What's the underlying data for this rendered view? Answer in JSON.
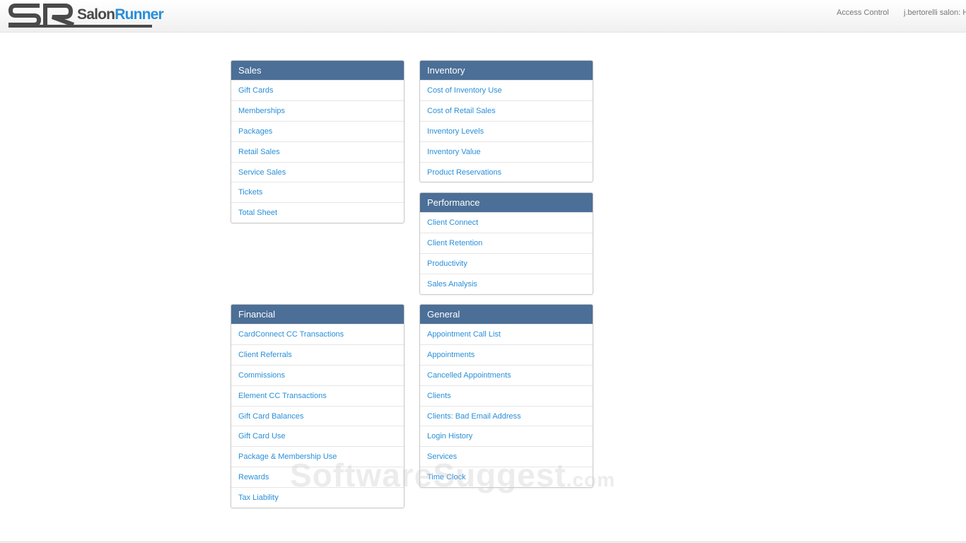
{
  "app": {
    "logo_salon": "Salon",
    "logo_runner": "Runner"
  },
  "top_nav": {
    "access_control": "Access Control",
    "salon_name": "j.bertorelli salon: Ho"
  },
  "panels": {
    "sales": {
      "title": "Sales",
      "items": [
        "Gift Cards",
        "Memberships",
        "Packages",
        "Retail Sales",
        "Service Sales",
        "Tickets",
        "Total Sheet"
      ]
    },
    "inventory": {
      "title": "Inventory",
      "items": [
        "Cost of Inventory Use",
        "Cost of Retail Sales",
        "Inventory Levels",
        "Inventory Value",
        "Product Reservations"
      ]
    },
    "performance": {
      "title": "Performance",
      "items": [
        "Client Connect",
        "Client Retention",
        "Productivity",
        "Sales Analysis"
      ]
    },
    "financial": {
      "title": "Financial",
      "items": [
        "CardConnect CC Transactions",
        "Client Referrals",
        "Commissions",
        "Element CC Transactions",
        "Gift Card Balances",
        "Gift Card Use",
        "Package & Membership Use",
        "Rewards",
        "Tax Liability"
      ]
    },
    "general": {
      "title": "General",
      "items": [
        "Appointment Call List",
        "Appointments",
        "Cancelled Appointments",
        "Clients",
        "Clients: Bad Email Address",
        "Login History",
        "Services",
        "Time Clock"
      ]
    }
  },
  "watermark": {
    "main": "SoftwareSuggest",
    "suffix": ".com"
  },
  "colors": {
    "panel_header": "#4b6f97",
    "link": "#2a8fd8",
    "logo_dark": "#4a4a4a"
  }
}
